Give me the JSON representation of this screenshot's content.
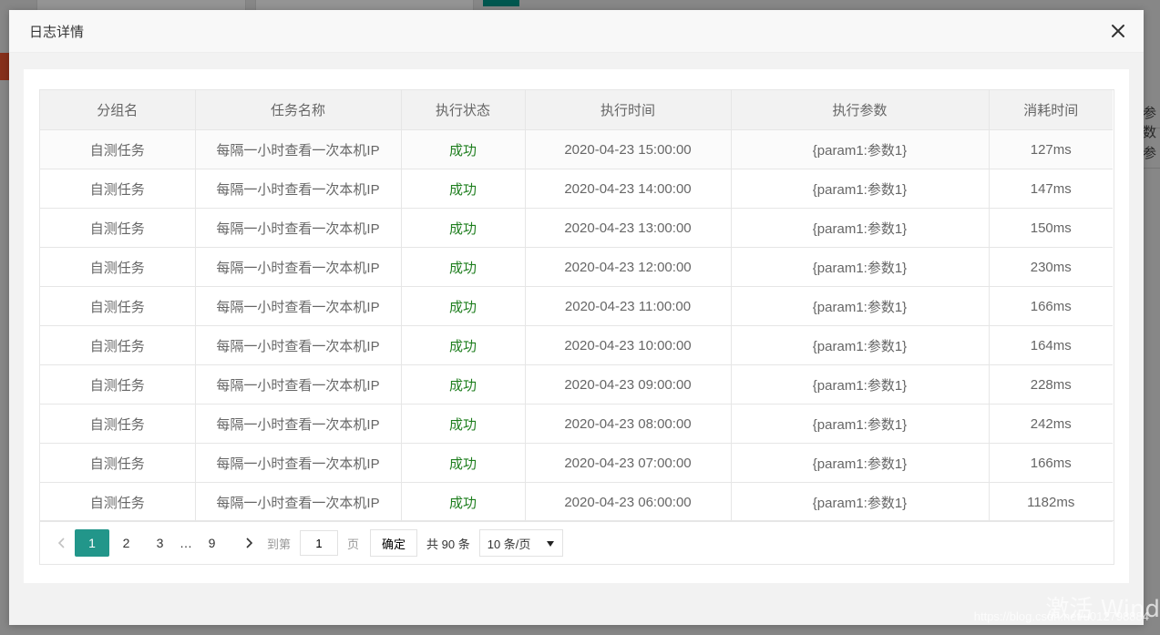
{
  "modal": {
    "title": "日志详情",
    "close_icon": "close-icon"
  },
  "table": {
    "columns": [
      "分组名",
      "任务名称",
      "执行状态",
      "执行时间",
      "执行参数",
      "消耗时间"
    ],
    "rows": [
      {
        "group": "自测任务",
        "task": "每隔一小时查看一次本机IP",
        "status": "成功",
        "time": "2020-04-23 15:00:00",
        "params": "{param1:参数1}",
        "cost": "127ms"
      },
      {
        "group": "自测任务",
        "task": "每隔一小时查看一次本机IP",
        "status": "成功",
        "time": "2020-04-23 14:00:00",
        "params": "{param1:参数1}",
        "cost": "147ms"
      },
      {
        "group": "自测任务",
        "task": "每隔一小时查看一次本机IP",
        "status": "成功",
        "time": "2020-04-23 13:00:00",
        "params": "{param1:参数1}",
        "cost": "150ms"
      },
      {
        "group": "自测任务",
        "task": "每隔一小时查看一次本机IP",
        "status": "成功",
        "time": "2020-04-23 12:00:00",
        "params": "{param1:参数1}",
        "cost": "230ms"
      },
      {
        "group": "自测任务",
        "task": "每隔一小时查看一次本机IP",
        "status": "成功",
        "time": "2020-04-23 11:00:00",
        "params": "{param1:参数1}",
        "cost": "166ms"
      },
      {
        "group": "自测任务",
        "task": "每隔一小时查看一次本机IP",
        "status": "成功",
        "time": "2020-04-23 10:00:00",
        "params": "{param1:参数1}",
        "cost": "164ms"
      },
      {
        "group": "自测任务",
        "task": "每隔一小时查看一次本机IP",
        "status": "成功",
        "time": "2020-04-23 09:00:00",
        "params": "{param1:参数1}",
        "cost": "228ms"
      },
      {
        "group": "自测任务",
        "task": "每隔一小时查看一次本机IP",
        "status": "成功",
        "time": "2020-04-23 08:00:00",
        "params": "{param1:参数1}",
        "cost": "242ms"
      },
      {
        "group": "自测任务",
        "task": "每隔一小时查看一次本机IP",
        "status": "成功",
        "time": "2020-04-23 07:00:00",
        "params": "{param1:参数1}",
        "cost": "166ms"
      },
      {
        "group": "自测任务",
        "task": "每隔一小时查看一次本机IP",
        "status": "成功",
        "time": "2020-04-23 06:00:00",
        "params": "{param1:参数1}",
        "cost": "1182ms"
      }
    ]
  },
  "pager": {
    "prev_icon": "chevron-left-icon",
    "pages": [
      "1",
      "2",
      "3"
    ],
    "ellipsis": "…",
    "last_page": "9",
    "next_icon": "chevron-right-icon",
    "goto_label": "到第",
    "goto_value": "1",
    "page_unit": "页",
    "confirm_label": "确定",
    "total_label": "共 90 条",
    "page_size": "10 条/页",
    "page_size_icon": "caret-down-icon"
  },
  "background": {
    "side_text_1": "参数",
    "side_text_2": "参"
  },
  "watermark": {
    "line1": "激活 Wind",
    "line2": "https://blog.csdn.net/u012798884"
  },
  "colors": {
    "accent": "#22968a",
    "success": "#1e7e1e",
    "header_bg": "#f2f2f2"
  }
}
